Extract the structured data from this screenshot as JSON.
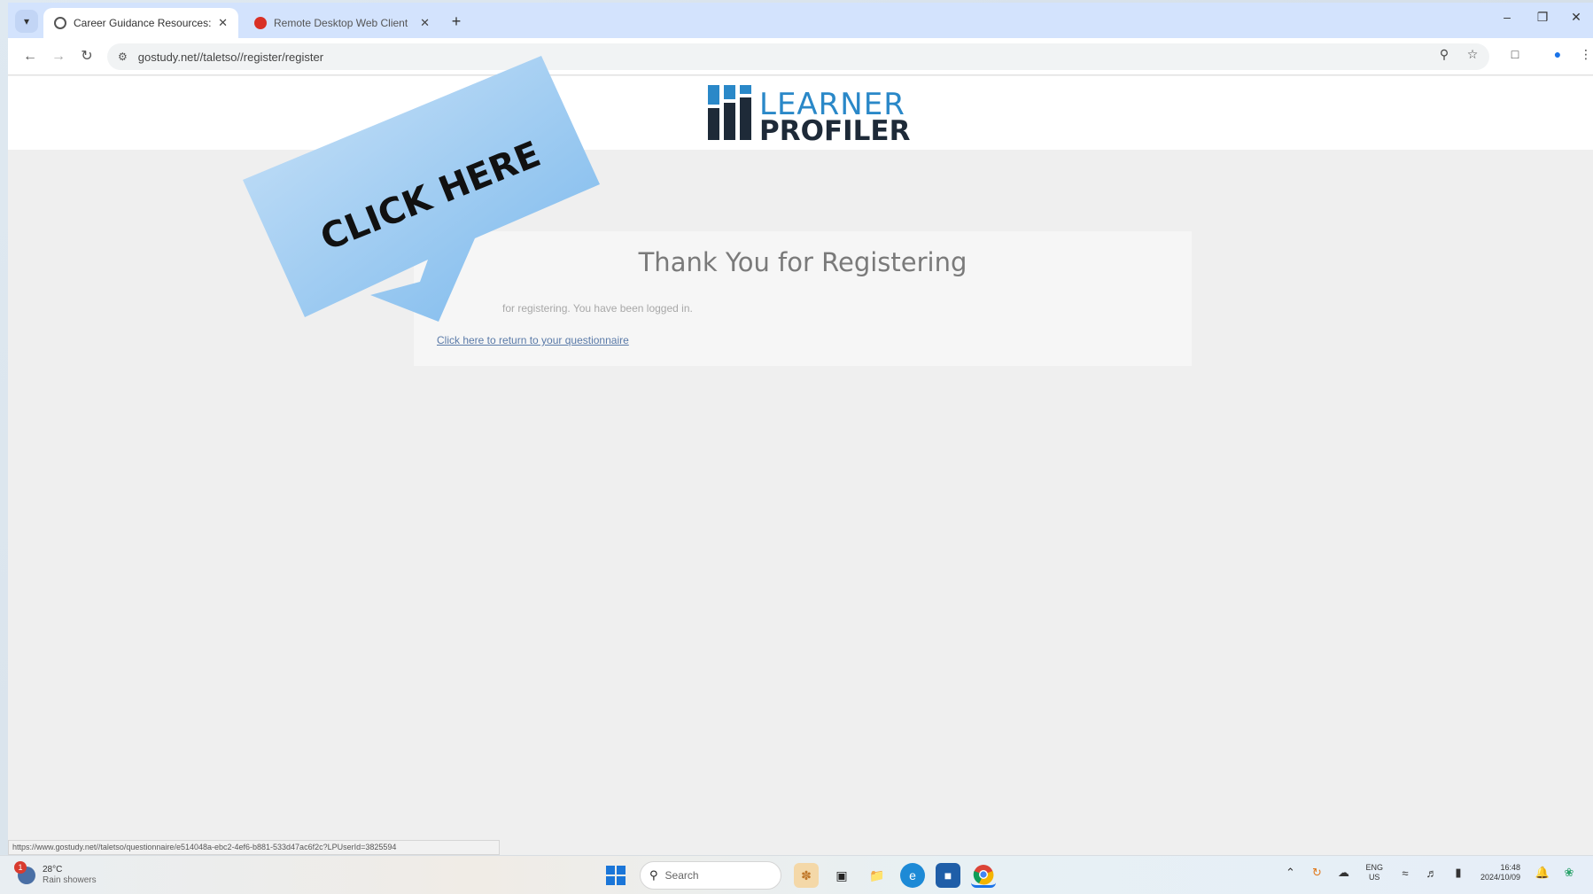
{
  "browser": {
    "tabs": [
      {
        "title": "Career Guidance Resources: O...",
        "active": true
      },
      {
        "title": "Remote Desktop Web Client",
        "active": false
      }
    ],
    "new_tab_symbol": "+",
    "url": "gostudy.net//taletso//register/register",
    "status_url": "https://www.gostudy.net//taletso/questionnaire/e514048a-ebc2-4ef6-b881-533d47ac6f2c?LPUserId=3825594"
  },
  "logo": {
    "word1": "LEARNER",
    "word2": "PROFILER",
    "colors": {
      "blue": "#2a88c8",
      "dark": "#1e2a38"
    }
  },
  "card": {
    "title": "Thank You for Registering",
    "text": "for registering. You have been logged in.",
    "link": "Click here to return to your questionnaire"
  },
  "overlay": {
    "text": "CLICK HERE",
    "color": "#8fc3ee"
  },
  "taskbar": {
    "weather_temp": "28°C",
    "weather_desc": "Rain showers",
    "weather_badge": "1",
    "search_placeholder": "Search",
    "lang_top": "ENG",
    "lang_bottom": "US",
    "time": "16:48",
    "date": "2024/10/09"
  }
}
